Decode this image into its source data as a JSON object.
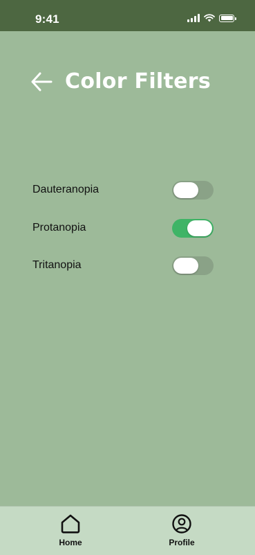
{
  "status_bar": {
    "time": "9:41"
  },
  "header": {
    "title": "Color Filters",
    "back_icon": "arrow-left-icon"
  },
  "filters": [
    {
      "label": "Dauteranopia",
      "enabled": false
    },
    {
      "label": "Protanopia",
      "enabled": true
    },
    {
      "label": "Tritanopia",
      "enabled": false
    }
  ],
  "tab_bar": {
    "tabs": [
      {
        "label": "Home",
        "icon": "home-icon"
      },
      {
        "label": "Profile",
        "icon": "profile-icon"
      }
    ]
  },
  "colors": {
    "background": "#9dba99",
    "status_bar": "#4d6741",
    "toggle_on": "#3fb466",
    "toggle_off": "#8aa287",
    "tab_bar": "#c5dac4"
  }
}
